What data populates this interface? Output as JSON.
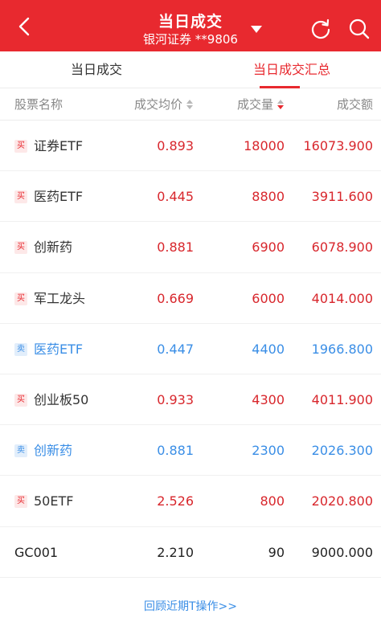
{
  "header": {
    "title": "当日成交",
    "account": "银河证券 **9806",
    "icons": {
      "back": "back-arrow-icon",
      "refresh": "refresh-icon",
      "search": "search-icon",
      "dropdown": "caret-down-icon"
    },
    "bg_color": "#e8292f"
  },
  "tabs": [
    {
      "label": "当日成交",
      "active": false
    },
    {
      "label": "当日成交汇总",
      "active": true
    }
  ],
  "columns": {
    "name": "股票名称",
    "price": "成交均价",
    "qty": "成交量",
    "amount": "成交额"
  },
  "rows": [
    {
      "side": "买",
      "type": "buy",
      "name": "证券ETF",
      "price": "0.893",
      "qty": "18000",
      "amount": "16073.900"
    },
    {
      "side": "买",
      "type": "buy",
      "name": "医药ETF",
      "price": "0.445",
      "qty": "8800",
      "amount": "3911.600"
    },
    {
      "side": "买",
      "type": "buy",
      "name": "创新药",
      "price": "0.881",
      "qty": "6900",
      "amount": "6078.900"
    },
    {
      "side": "买",
      "type": "buy",
      "name": "军工龙头",
      "price": "0.669",
      "qty": "6000",
      "amount": "4014.000"
    },
    {
      "side": "卖",
      "type": "sell",
      "name": "医药ETF",
      "price": "0.447",
      "qty": "4400",
      "amount": "1966.800"
    },
    {
      "side": "买",
      "type": "buy",
      "name": "创业板50",
      "price": "0.933",
      "qty": "4300",
      "amount": "4011.900"
    },
    {
      "side": "卖",
      "type": "sell",
      "name": "创新药",
      "price": "0.881",
      "qty": "2300",
      "amount": "2026.300"
    },
    {
      "side": "买",
      "type": "buy",
      "name": "50ETF",
      "price": "2.526",
      "qty": "800",
      "amount": "2020.800"
    },
    {
      "side": "",
      "type": "none",
      "name": "GC001",
      "price": "2.210",
      "qty": "90",
      "amount": "9000.000"
    }
  ],
  "footer": {
    "link": "回顾近期T操作>>"
  },
  "colors": {
    "buy": "#d8262c",
    "sell": "#3a8ee6",
    "accent": "#e8292f"
  }
}
